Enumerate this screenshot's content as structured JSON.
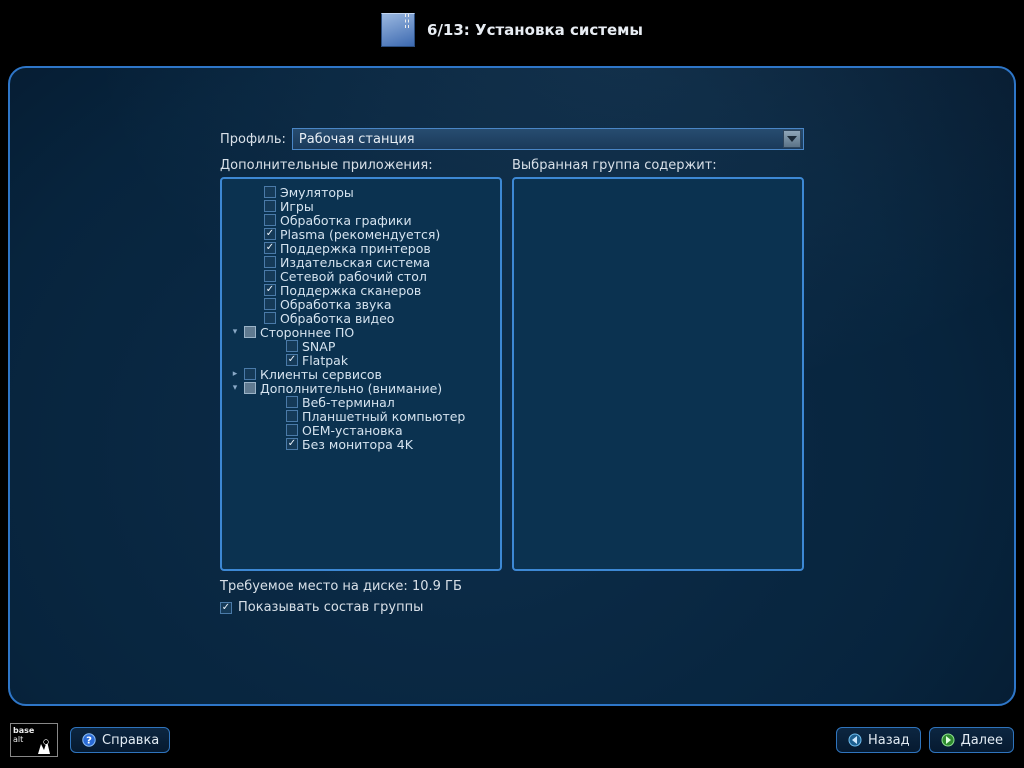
{
  "header": {
    "title": "6/13: Установка системы"
  },
  "profile": {
    "label": "Профиль:",
    "value": "Рабочая станция"
  },
  "columns": {
    "left_title": "Дополнительные приложения:",
    "right_title": "Выбранная группа содержит:"
  },
  "tree": [
    {
      "indent": 1,
      "expand": "",
      "check": "off",
      "label": "Эмуляторы"
    },
    {
      "indent": 1,
      "expand": "",
      "check": "off",
      "label": "Игры"
    },
    {
      "indent": 1,
      "expand": "",
      "check": "off",
      "label": "Обработка графики"
    },
    {
      "indent": 1,
      "expand": "",
      "check": "on",
      "label": "Plasma (рекомендуется)"
    },
    {
      "indent": 1,
      "expand": "",
      "check": "on",
      "label": "Поддержка принтеров"
    },
    {
      "indent": 1,
      "expand": "",
      "check": "off",
      "label": "Издательская система"
    },
    {
      "indent": 1,
      "expand": "",
      "check": "off",
      "label": "Сетевой рабочий стол"
    },
    {
      "indent": 1,
      "expand": "",
      "check": "on",
      "label": "Поддержка сканеров"
    },
    {
      "indent": 1,
      "expand": "",
      "check": "off",
      "label": "Обработка звука"
    },
    {
      "indent": 1,
      "expand": "",
      "check": "off",
      "label": "Обработка видео"
    },
    {
      "indent": 0,
      "expand": "open",
      "check": "tri",
      "label": "Стороннее ПО"
    },
    {
      "indent": 2,
      "expand": "",
      "check": "off",
      "label": "SNAP"
    },
    {
      "indent": 2,
      "expand": "",
      "check": "on",
      "label": "Flatpak"
    },
    {
      "indent": 0,
      "expand": "closed",
      "check": "off",
      "label": "Клиенты сервисов"
    },
    {
      "indent": 0,
      "expand": "open",
      "check": "tri",
      "label": "Дополнительно (внимание)"
    },
    {
      "indent": 2,
      "expand": "",
      "check": "off",
      "label": "Веб-терминал"
    },
    {
      "indent": 2,
      "expand": "",
      "check": "off",
      "label": "Планшетный компьютер"
    },
    {
      "indent": 2,
      "expand": "",
      "check": "off",
      "label": "OEM-установка"
    },
    {
      "indent": 2,
      "expand": "",
      "check": "on",
      "label": "Без монитора 4K"
    }
  ],
  "meta": {
    "disk_label": "Требуемое место на диске: 10.9 ГБ",
    "show_contents": "Показывать состав группы",
    "show_contents_checked": true
  },
  "logo": {
    "line1": "base",
    "line2": "alt"
  },
  "buttons": {
    "help": "Справка",
    "back": "Назад",
    "next": "Далее"
  }
}
